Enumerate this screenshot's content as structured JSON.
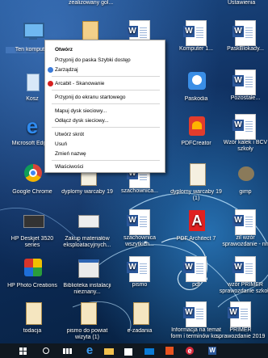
{
  "desktop": {
    "top_labels": [
      "zealizowany gol...",
      "Ustawienia"
    ],
    "icons": [
      {
        "label": "Ten komputer"
      },
      {
        "label": ""
      },
      {
        "label": ""
      },
      {
        "label": "Komputer 1..."
      },
      {
        "label": "PaskBlokady..."
      },
      {
        "label": "Kosz"
      },
      {
        "label": "Paskodia"
      },
      {
        "label": "Pozostałe..."
      },
      {
        "label": "Microsoft Edge"
      },
      {
        "label": "PDFCreator"
      },
      {
        "label": "Wzór kalek i BCV szkoły"
      },
      {
        "label": "Google Chrome"
      },
      {
        "label": "dyplomy warcaby 19"
      },
      {
        "label": "szachownica..."
      },
      {
        "label": "dyplomy warcaby 19 (1)"
      },
      {
        "label": "gimp"
      },
      {
        "label": "HP Deskjet 3520 series"
      },
      {
        "label": "Zakup materiałów eksploatacyjnych..."
      },
      {
        "label": "szachownica wszytkich..."
      },
      {
        "label": "PDF Architect 7"
      },
      {
        "label": "zil wzór sprawozdanie - nn"
      },
      {
        "label": "HP Photo Creations"
      },
      {
        "label": "Biblioteka instalacji nieznany..."
      },
      {
        "label": "pismo"
      },
      {
        "label": "pdf"
      },
      {
        "label": "wzór PRIMER sprawozdanie szkoły"
      },
      {
        "label": "todacja"
      },
      {
        "label": "pismo do powiat wizyta (1)"
      },
      {
        "label": "e-zadania"
      },
      {
        "label": "Informacja na temat form i terminów ko..."
      },
      {
        "label": "PRIMER sprawozdanie 2019"
      }
    ]
  },
  "context_menu": {
    "items": [
      {
        "label": "Otwórz",
        "bold": true
      },
      {
        "label": "Przypnij do paska Szybki dostęp"
      },
      {
        "label": "Zarządzaj"
      },
      {
        "label": "Arcabit - Skanowanie"
      },
      {
        "label": "Przypnij do ekranu startowego"
      },
      {
        "label": "Mapuj dysk sieciowy..."
      },
      {
        "label": "Odłącz dysk sieciowy..."
      },
      {
        "label": "Utwórz skrót"
      },
      {
        "label": "Usuń"
      },
      {
        "label": "Zmień nazwę"
      },
      {
        "label": "Właściwości"
      }
    ]
  },
  "taskbar": {
    "icons": [
      "windows-start-icon",
      "search-icon",
      "task-view-icon",
      "edge-icon",
      "file-explorer-icon",
      "store-icon",
      "mail-icon",
      "office-icon",
      "ie-icon",
      "word-icon"
    ],
    "accent": "#0078d7"
  }
}
